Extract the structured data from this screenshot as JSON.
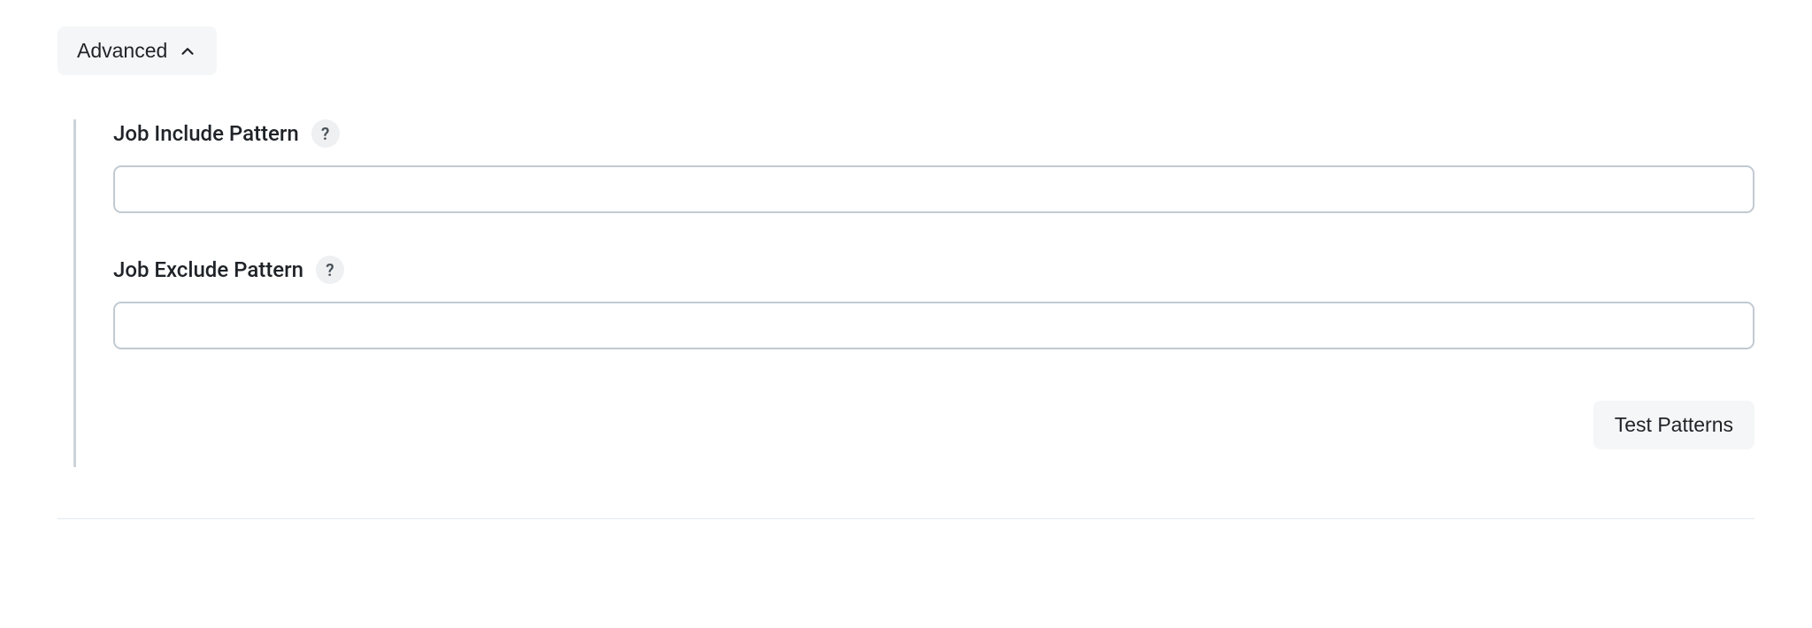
{
  "toggle": {
    "label": "Advanced"
  },
  "fields": {
    "include": {
      "label": "Job Include Pattern",
      "help": "?",
      "value": "",
      "placeholder": ""
    },
    "exclude": {
      "label": "Job Exclude Pattern",
      "help": "?",
      "value": "",
      "placeholder": ""
    }
  },
  "actions": {
    "test_patterns": "Test Patterns"
  }
}
